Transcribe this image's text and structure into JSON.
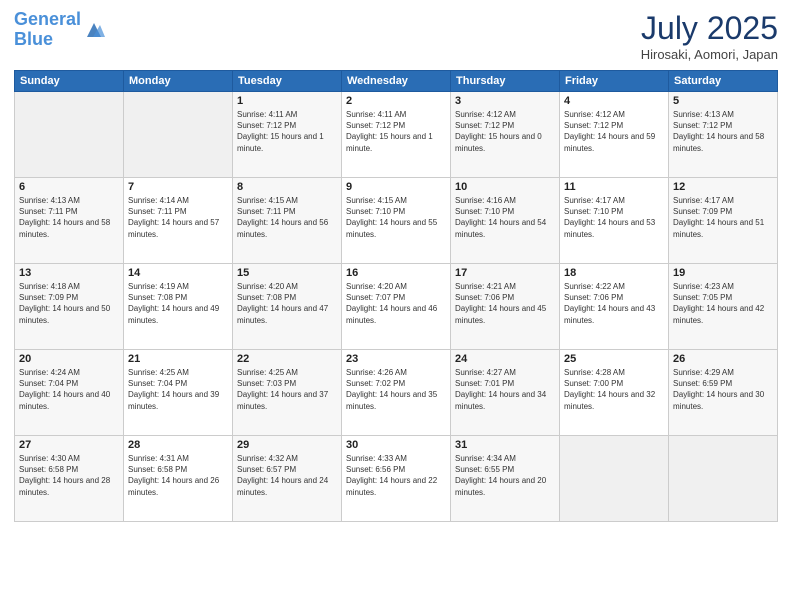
{
  "header": {
    "logo_line1": "General",
    "logo_line2": "Blue",
    "month_title": "July 2025",
    "location": "Hirosaki, Aomori, Japan"
  },
  "days_of_week": [
    "Sunday",
    "Monday",
    "Tuesday",
    "Wednesday",
    "Thursday",
    "Friday",
    "Saturday"
  ],
  "weeks": [
    [
      {
        "num": "",
        "info": ""
      },
      {
        "num": "",
        "info": ""
      },
      {
        "num": "1",
        "info": "Sunrise: 4:11 AM\nSunset: 7:12 PM\nDaylight: 15 hours and 1 minute."
      },
      {
        "num": "2",
        "info": "Sunrise: 4:11 AM\nSunset: 7:12 PM\nDaylight: 15 hours and 1 minute."
      },
      {
        "num": "3",
        "info": "Sunrise: 4:12 AM\nSunset: 7:12 PM\nDaylight: 15 hours and 0 minutes."
      },
      {
        "num": "4",
        "info": "Sunrise: 4:12 AM\nSunset: 7:12 PM\nDaylight: 14 hours and 59 minutes."
      },
      {
        "num": "5",
        "info": "Sunrise: 4:13 AM\nSunset: 7:12 PM\nDaylight: 14 hours and 58 minutes."
      }
    ],
    [
      {
        "num": "6",
        "info": "Sunrise: 4:13 AM\nSunset: 7:11 PM\nDaylight: 14 hours and 58 minutes."
      },
      {
        "num": "7",
        "info": "Sunrise: 4:14 AM\nSunset: 7:11 PM\nDaylight: 14 hours and 57 minutes."
      },
      {
        "num": "8",
        "info": "Sunrise: 4:15 AM\nSunset: 7:11 PM\nDaylight: 14 hours and 56 minutes."
      },
      {
        "num": "9",
        "info": "Sunrise: 4:15 AM\nSunset: 7:10 PM\nDaylight: 14 hours and 55 minutes."
      },
      {
        "num": "10",
        "info": "Sunrise: 4:16 AM\nSunset: 7:10 PM\nDaylight: 14 hours and 54 minutes."
      },
      {
        "num": "11",
        "info": "Sunrise: 4:17 AM\nSunset: 7:10 PM\nDaylight: 14 hours and 53 minutes."
      },
      {
        "num": "12",
        "info": "Sunrise: 4:17 AM\nSunset: 7:09 PM\nDaylight: 14 hours and 51 minutes."
      }
    ],
    [
      {
        "num": "13",
        "info": "Sunrise: 4:18 AM\nSunset: 7:09 PM\nDaylight: 14 hours and 50 minutes."
      },
      {
        "num": "14",
        "info": "Sunrise: 4:19 AM\nSunset: 7:08 PM\nDaylight: 14 hours and 49 minutes."
      },
      {
        "num": "15",
        "info": "Sunrise: 4:20 AM\nSunset: 7:08 PM\nDaylight: 14 hours and 47 minutes."
      },
      {
        "num": "16",
        "info": "Sunrise: 4:20 AM\nSunset: 7:07 PM\nDaylight: 14 hours and 46 minutes."
      },
      {
        "num": "17",
        "info": "Sunrise: 4:21 AM\nSunset: 7:06 PM\nDaylight: 14 hours and 45 minutes."
      },
      {
        "num": "18",
        "info": "Sunrise: 4:22 AM\nSunset: 7:06 PM\nDaylight: 14 hours and 43 minutes."
      },
      {
        "num": "19",
        "info": "Sunrise: 4:23 AM\nSunset: 7:05 PM\nDaylight: 14 hours and 42 minutes."
      }
    ],
    [
      {
        "num": "20",
        "info": "Sunrise: 4:24 AM\nSunset: 7:04 PM\nDaylight: 14 hours and 40 minutes."
      },
      {
        "num": "21",
        "info": "Sunrise: 4:25 AM\nSunset: 7:04 PM\nDaylight: 14 hours and 39 minutes."
      },
      {
        "num": "22",
        "info": "Sunrise: 4:25 AM\nSunset: 7:03 PM\nDaylight: 14 hours and 37 minutes."
      },
      {
        "num": "23",
        "info": "Sunrise: 4:26 AM\nSunset: 7:02 PM\nDaylight: 14 hours and 35 minutes."
      },
      {
        "num": "24",
        "info": "Sunrise: 4:27 AM\nSunset: 7:01 PM\nDaylight: 14 hours and 34 minutes."
      },
      {
        "num": "25",
        "info": "Sunrise: 4:28 AM\nSunset: 7:00 PM\nDaylight: 14 hours and 32 minutes."
      },
      {
        "num": "26",
        "info": "Sunrise: 4:29 AM\nSunset: 6:59 PM\nDaylight: 14 hours and 30 minutes."
      }
    ],
    [
      {
        "num": "27",
        "info": "Sunrise: 4:30 AM\nSunset: 6:58 PM\nDaylight: 14 hours and 28 minutes."
      },
      {
        "num": "28",
        "info": "Sunrise: 4:31 AM\nSunset: 6:58 PM\nDaylight: 14 hours and 26 minutes."
      },
      {
        "num": "29",
        "info": "Sunrise: 4:32 AM\nSunset: 6:57 PM\nDaylight: 14 hours and 24 minutes."
      },
      {
        "num": "30",
        "info": "Sunrise: 4:33 AM\nSunset: 6:56 PM\nDaylight: 14 hours and 22 minutes."
      },
      {
        "num": "31",
        "info": "Sunrise: 4:34 AM\nSunset: 6:55 PM\nDaylight: 14 hours and 20 minutes."
      },
      {
        "num": "",
        "info": ""
      },
      {
        "num": "",
        "info": ""
      }
    ]
  ]
}
